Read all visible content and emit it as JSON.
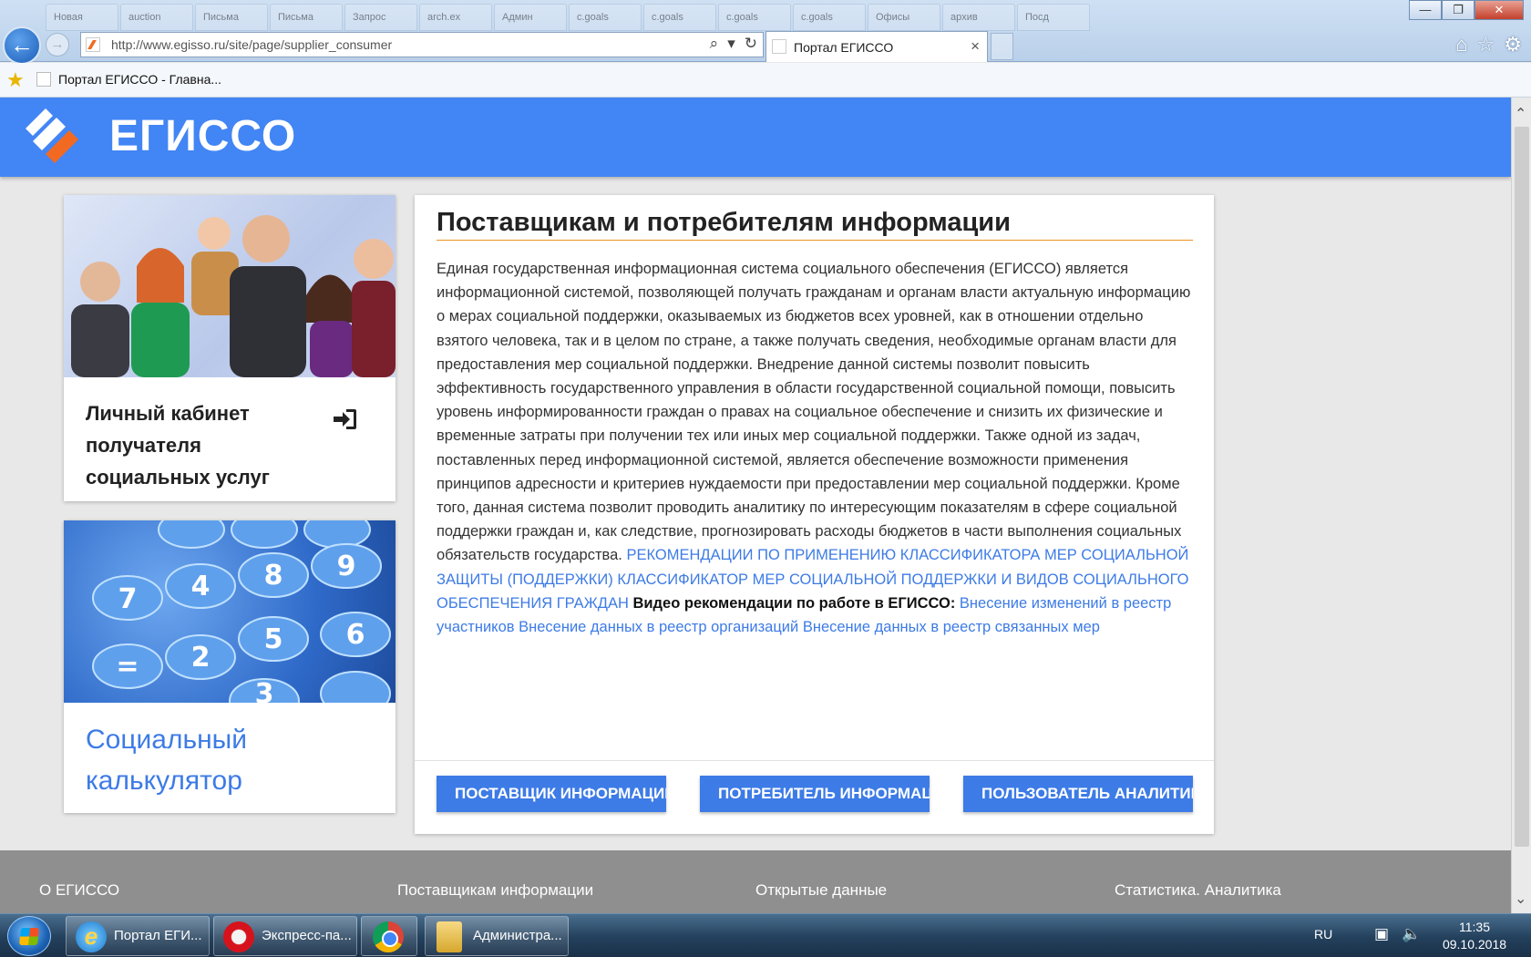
{
  "browser": {
    "background_tabs": [
      "Новая",
      "auction",
      "Письма",
      "Письма",
      "Запрос",
      "arch.ex",
      "Админ",
      "с.goals",
      "с.goals",
      "с.goals",
      "с.goals",
      "Офисы",
      "арxив",
      "Пoсд"
    ],
    "address_url": "http://www.egisso.ru/site/page/supplier_consumer",
    "tab_title": "Портал ЕГИССО",
    "tab_close": "×",
    "back_glyph": "←",
    "forward_glyph": "→",
    "favorites_item": "Портал ЕГИССО - Главна...",
    "window_buttons": {
      "minimize": "—",
      "maximize": "❐",
      "close": "✕"
    },
    "icons": [
      "search-icon",
      "dropdown-icon",
      "refresh-icon",
      "home-icon",
      "favorites-star-icon",
      "settings-gear-icon"
    ]
  },
  "site": {
    "name": "ЕГИССО",
    "colors": {
      "header": "#4285f4",
      "accent": "#3d7be6",
      "underline": "#f0901e",
      "footer": "#8f8f8f"
    }
  },
  "cabinet_card": {
    "title": "Личный кабинет получателя социальных услуг"
  },
  "calc_card": {
    "title": "Социальный калькулятор"
  },
  "main": {
    "title": "Поставщикам и потребителям информации",
    "body_text": "Единая государственная информационная система социального обеспечения (ЕГИССО) является информационной системой, позволяющей получать гражданам и органам власти актуальную информацию о мерах социальной поддержки, оказываемых из бюджетов всех уровней, как в отношении отдельно взятого человека, так и в целом по стране, а также получать сведения, необходимые органам власти для предоставления мер социальной поддержки. Внедрение данной системы позволит повысить эффективность государственного управления в области государственной социальной помощи, повысить уровень информированности граждан о правах на социальное обеспечение и снизить их физические и временные затраты при получении тех или иных мер социальной поддержки. Также одной из задач, поставленных перед информационной системой, является обеспечение возможности применения принципов адресности и критериев нуждаемости при предоставлении мер социальной поддержки. Кроме того, данная система позволит проводить аналитику по интересующим показателям в сфере социальной поддержки граждан и, как следствие, прогнозировать расходы бюджетов в части выполнения социальных обязательств государства.",
    "link_recommendations": "РЕКОМЕНДАЦИИ ПО ПРИМЕНЕНИЮ КЛАССИФИКАТОРА МЕР СОЦИАЛЬНОЙ ЗАЩИТЫ (ПОДДЕРЖКИ)",
    "link_classifier": "КЛАССИФИКАТОР МЕР СОЦИАЛЬНОЙ ПОДДЕРЖКИ И ВИДОВ СОЦИАЛЬНОГО ОБЕСПЕЧЕНИЯ ГРАЖДАН",
    "video_heading": "Видео рекомендации по работе в ЕГИССО:",
    "video_links": [
      "Внесение изменений в реестр участников",
      "Внесение данных в реестр организаций",
      "Внесение данных в реестр связанных мер"
    ],
    "buttons": {
      "supplier": "ПОСТАВЩИК ИНФОРМАЦИИ",
      "consumer": "ПОТРЕБИТЕЛЬ ИНФОРМАЦИИ",
      "analytics": "ПОЛЬЗОВАТЕЛЬ АНАЛИТИКИ"
    }
  },
  "footer": {
    "links": [
      "О ЕГИССО",
      "Поставщикам информации",
      "Открытые данные",
      "Статистика. Аналитика"
    ]
  },
  "taskbar": {
    "items": {
      "ie": "Портал ЕГИ...",
      "opera": "Экспресс-па...",
      "explorer": "Администра..."
    },
    "language": "RU",
    "time": "11:35",
    "date": "09.10.2018"
  }
}
